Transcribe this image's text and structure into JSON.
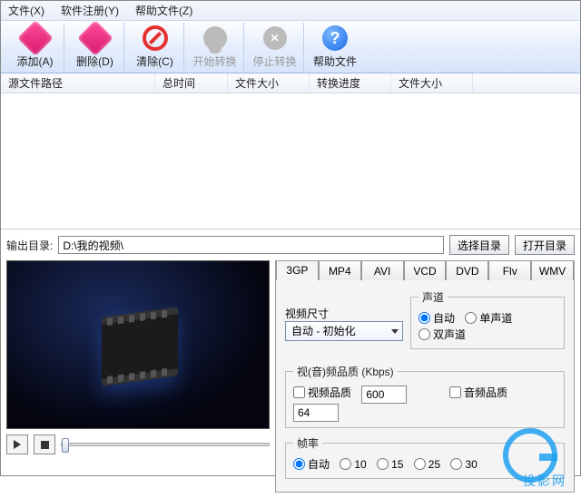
{
  "menu": {
    "file": "文件(X)",
    "register": "软件注册(Y)",
    "help": "帮助文件(Z)"
  },
  "toolbar": {
    "add": "添加(A)",
    "del": "删除(D)",
    "clear": "清除(C)",
    "start": "开始转换",
    "stop": "停止转换",
    "help": "帮助文件"
  },
  "columns": {
    "src": "源文件路径",
    "total": "总时间",
    "size1": "文件大小",
    "progress": "转换进度",
    "size2": "文件大小"
  },
  "output": {
    "label": "输出目录:",
    "path": "D:\\我的视频\\",
    "choose": "选择目录",
    "open": "打开目录"
  },
  "tabs": [
    "3GP",
    "MP4",
    "AVI",
    "VCD",
    "DVD",
    "Flv",
    "WMV"
  ],
  "video": {
    "size_label": "视频尺寸",
    "size_value": "自动 - 初始化",
    "channel_legend": "声道",
    "ch_auto": "自动",
    "ch_mono": "单声道",
    "ch_stereo": "双声道",
    "quality_legend": "视(音)频品质 (Kbps)",
    "vq_label": "视频品质",
    "vq_value": "600",
    "aq_label": "音频品质",
    "aq_value": "64",
    "fps_legend": "帧率",
    "fps_auto": "自动",
    "fps_10": "10",
    "fps_15": "15",
    "fps_25": "25",
    "fps_30": "30"
  },
  "watermark": "投影网"
}
